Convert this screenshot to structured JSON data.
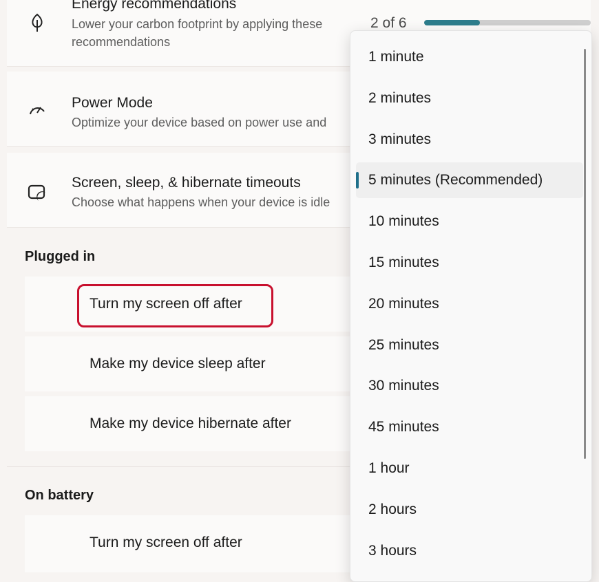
{
  "cards": {
    "energy": {
      "title": "Energy recommendations",
      "desc": "Lower your carbon footprint by applying these recommendations",
      "progress_text": "2 of 6",
      "progress_fraction": 0.333
    },
    "power_mode": {
      "title": "Power Mode",
      "desc": "Optimize your device based on power use and"
    },
    "timeouts": {
      "title": "Screen, sleep, & hibernate timeouts",
      "desc": "Choose what happens when your device is idle"
    }
  },
  "plugged_in": {
    "label": "Plugged in",
    "rows": [
      "Turn my screen off after",
      "Make my device sleep after",
      "Make my device hibernate after"
    ]
  },
  "on_battery": {
    "label": "On battery",
    "rows": [
      "Turn my screen off after"
    ]
  },
  "dropdown": {
    "options": [
      "1 minute",
      "2 minutes",
      "3 minutes",
      "5 minutes (Recommended)",
      "10 minutes",
      "15 minutes",
      "20 minutes",
      "25 minutes",
      "30 minutes",
      "45 minutes",
      "1 hour",
      "2 hours",
      "3 hours"
    ],
    "selected_index": 3
  },
  "colors": {
    "accent": "#1e6f8a",
    "highlight_box": "#c8102e",
    "progress": "#2d7d8c"
  },
  "icons": {
    "energy": "leaf-icon",
    "power_mode": "speedometer-icon",
    "timeouts": "screen-sleep-icon"
  }
}
